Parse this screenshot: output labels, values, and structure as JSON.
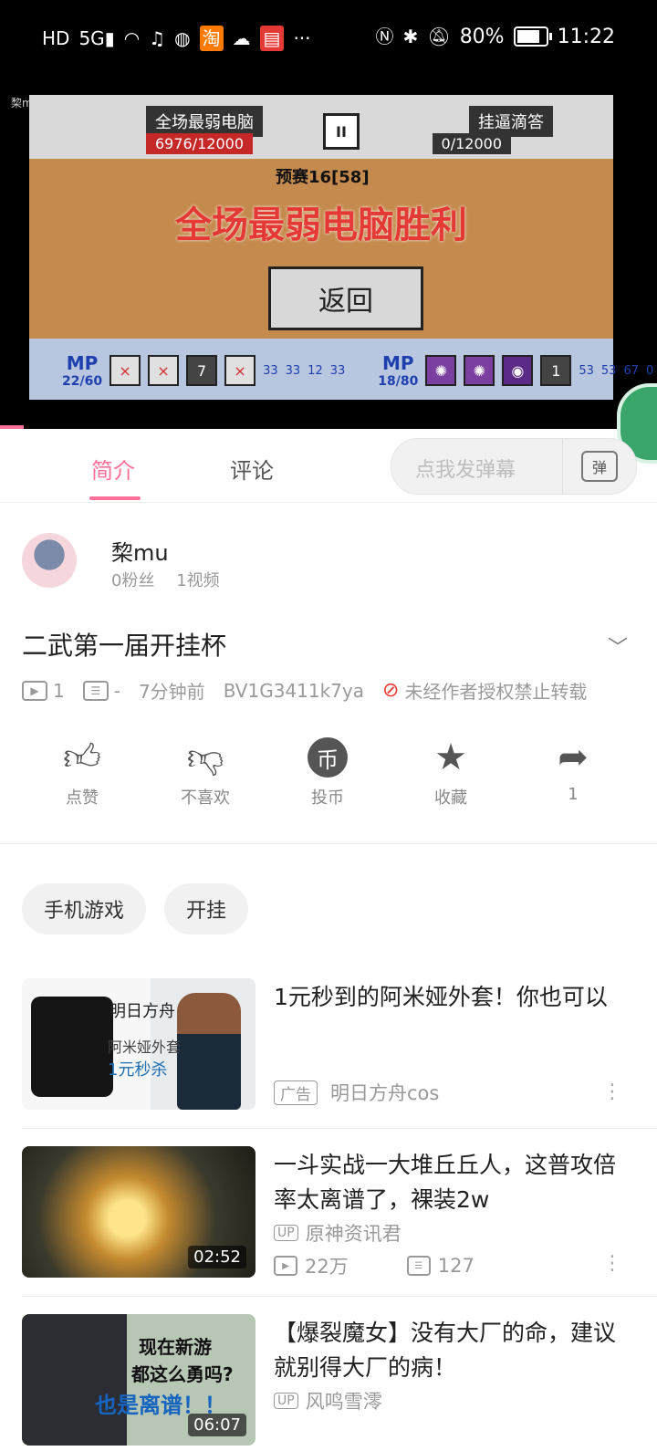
{
  "status_bar": {
    "left_icons": [
      "hd-icon",
      "5g-icon",
      "wifi-icon",
      "music-icon",
      "sports-icon",
      "taobao-icon",
      "cloud-icon",
      "book-icon"
    ],
    "overflow": "···",
    "battery_percent": "80%",
    "battery_level": 0.8,
    "time": "11:22"
  },
  "video": {
    "watermark": "棃mu",
    "player1_name": "全场最弱电脑",
    "player1_score": "6976/12000",
    "player2_name": "挂逼滴答",
    "player2_score": "0/12000",
    "round": "预赛16[58]",
    "victory_text": "全场最弱电脑胜利",
    "return_label": "返回",
    "hud": {
      "left": {
        "mp_label": "MP",
        "mp_value": "22/60",
        "slots": [
          "×",
          "×",
          "7",
          "×"
        ],
        "counts": [
          "33",
          "33",
          "12",
          "33"
        ]
      },
      "right": {
        "mp_label": "MP",
        "mp_value": "18/80",
        "slots": [
          "✺",
          "✺",
          "◉",
          "1"
        ],
        "counts": [
          "53",
          "53",
          "67",
          "0"
        ]
      }
    },
    "progress": 0.036
  },
  "tabs": {
    "intro": "简介",
    "comments": "评论",
    "danmaku_placeholder": "点我发弹幕",
    "danmaku_icon_text": "弹"
  },
  "uploader": {
    "name": "棃mu",
    "fans": "0粉丝",
    "videos": "1视频"
  },
  "video_info": {
    "title": "二武第一届开挂杯",
    "play_count": "1",
    "danmaku_count": "-",
    "time_ago": "7分钟前",
    "bvid": "BV1G3411k7ya",
    "copyright_note": "未经作者授权禁止转载"
  },
  "actions": {
    "like": "点赞",
    "dislike": "不喜欢",
    "coin": "投币",
    "favorite": "收藏",
    "share_count": "1"
  },
  "tags": [
    "手机游戏",
    "开挂"
  ],
  "recommendations": [
    {
      "title": "1元秒到的阿米娅外套！你也可以",
      "badge": "广告",
      "source": "明日方舟cos",
      "thumb_brand": "明日方舟",
      "thumb_line1": "阿米娅外套",
      "thumb_line2": "1元秒杀"
    },
    {
      "title": "一斗实战一大堆丘丘人，这普攻倍率太离谱了，裸装2w",
      "up_tag": "UP",
      "uploader": "原神资讯君",
      "views": "22万",
      "danmaku": "127",
      "duration": "02:52"
    },
    {
      "title": "【爆裂魔女】没有大厂的命，建议就别得大厂的病！",
      "up_tag": "UP",
      "uploader": "风鸣雪澪",
      "duration": "06:07",
      "caption1": "现在新游",
      "caption2": "都这么勇吗?",
      "caption3": "也是离谱！！"
    }
  ],
  "colors": {
    "accent": "#fb7299",
    "text": "#212121",
    "muted": "#999999",
    "chip_bg": "#f1f1f1"
  }
}
